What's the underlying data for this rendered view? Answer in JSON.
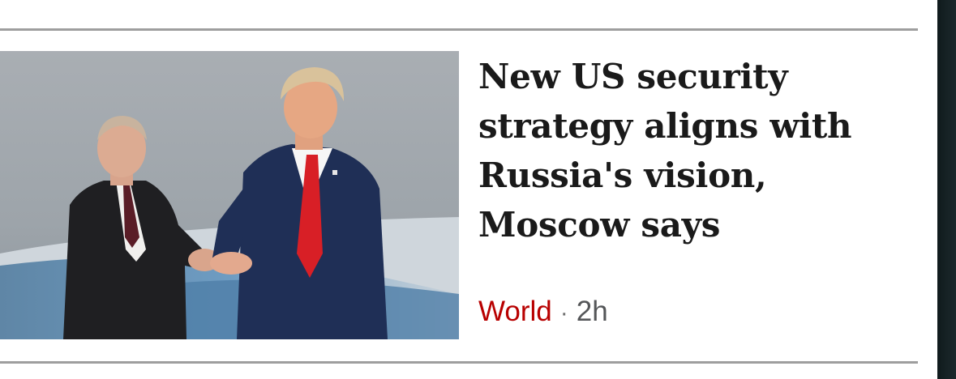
{
  "story": {
    "headline": "New US security strategy aligns with Russia's vision, Moscow says",
    "section": "World",
    "separator": "·",
    "timestamp": "2h",
    "image": {
      "description": "two-men-shaking-hands-photo"
    }
  },
  "colors": {
    "section": "#b80000",
    "divider": "#9e9e9e",
    "headline": "#1a1a1a",
    "timestamp": "#545658"
  }
}
